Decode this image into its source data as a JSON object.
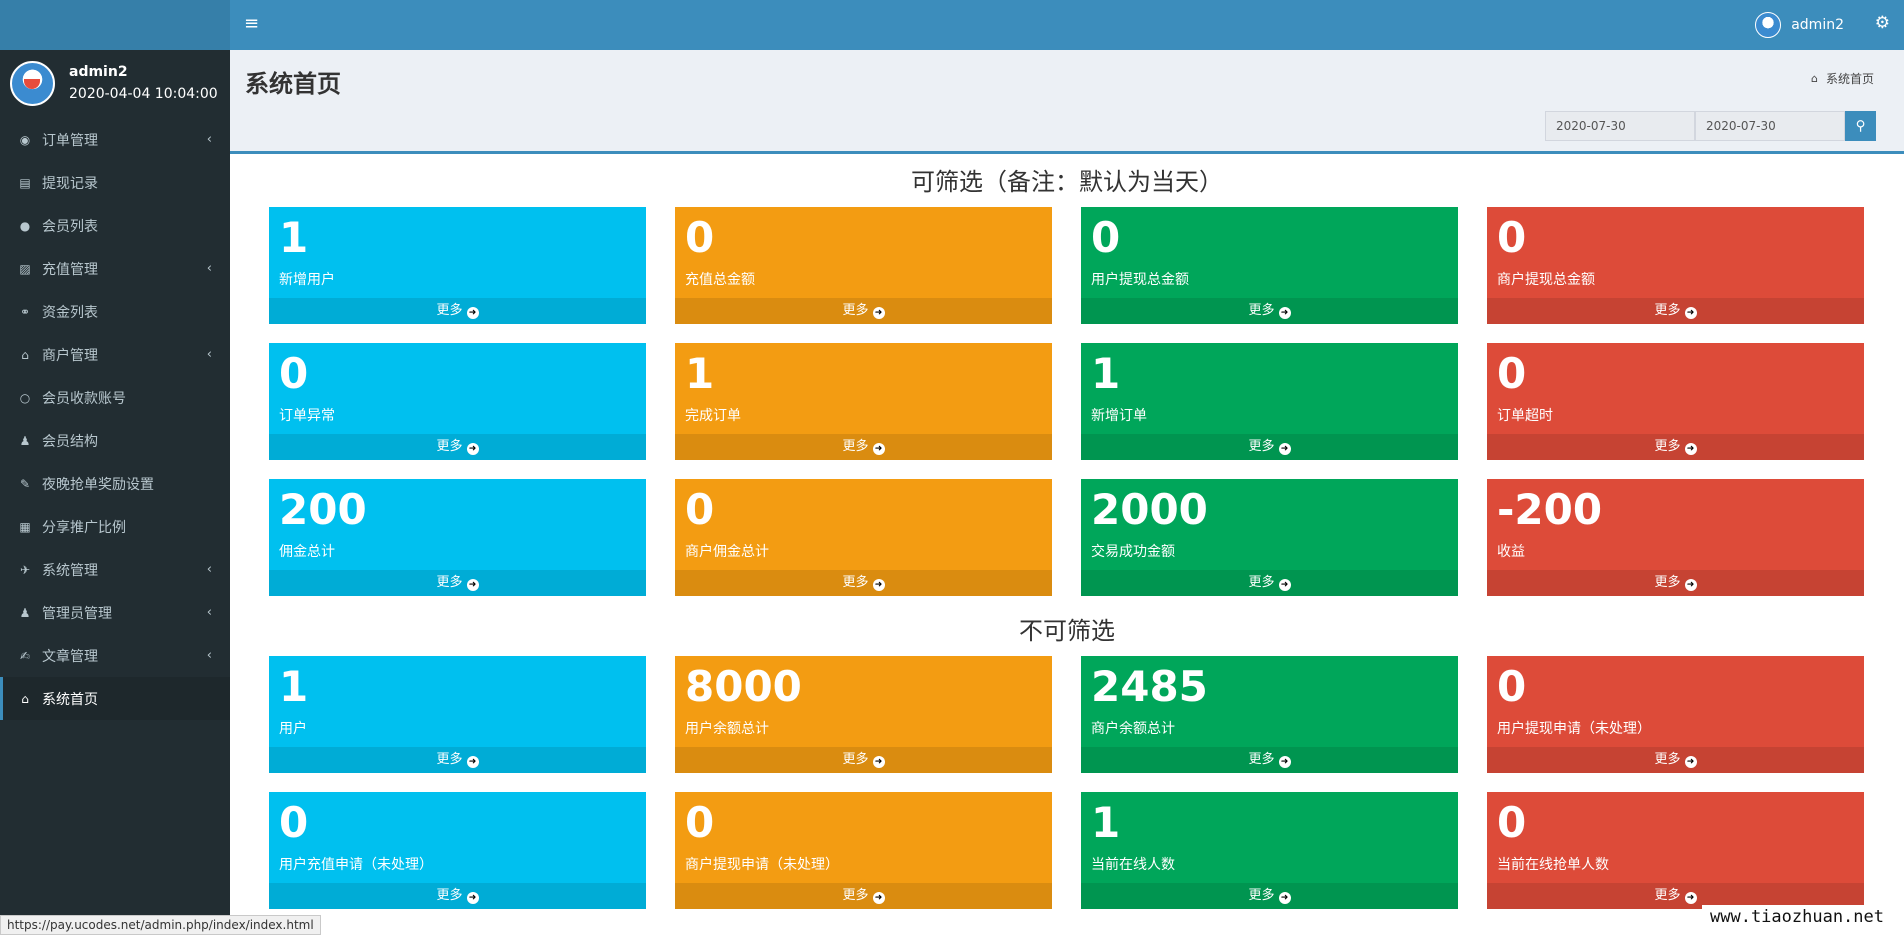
{
  "sidebar": {
    "user": {
      "name": "admin2",
      "time": "2020-04-04 10:04:00"
    },
    "items": [
      {
        "label": "订单管理",
        "icon": "◉",
        "chevron": true
      },
      {
        "label": "提现记录",
        "icon": "▤",
        "chevron": false
      },
      {
        "label": "会员列表",
        "icon": "●",
        "chevron": false
      },
      {
        "label": "充值管理",
        "icon": "▨",
        "chevron": true
      },
      {
        "label": "资金列表",
        "icon": "⚭",
        "chevron": false
      },
      {
        "label": "商户管理",
        "icon": "⌂",
        "chevron": true
      },
      {
        "label": "会员收款账号",
        "icon": "○",
        "chevron": false
      },
      {
        "label": "会员结构",
        "icon": "♟",
        "chevron": false
      },
      {
        "label": "夜晚抢单奖励设置",
        "icon": "✎",
        "chevron": false
      },
      {
        "label": "分享推广比例",
        "icon": "▦",
        "chevron": false
      },
      {
        "label": "系统管理",
        "icon": "✈",
        "chevron": true
      },
      {
        "label": "管理员管理",
        "icon": "♟",
        "chevron": true
      },
      {
        "label": "文章管理",
        "icon": "✍",
        "chevron": true
      },
      {
        "label": "系统首页",
        "icon": "⌂",
        "chevron": false
      }
    ],
    "chevron_glyph": "‹"
  },
  "header": {
    "toggle_icon": "≡",
    "username": "admin2",
    "gear_icon": "⚙"
  },
  "content": {
    "title": "系统首页",
    "breadcrumb_icon": "⌂",
    "breadcrumb": "系统首页",
    "date_from": "2020-07-30",
    "date_to": "2020-07-30",
    "search_icon": "⚲"
  },
  "sections": {
    "filterable": "可筛选（备注：默认为当天）",
    "non_filterable": "不可筛选"
  },
  "more_label": "更多",
  "more_arrow": "➜",
  "cards_filterable": [
    {
      "value": "1",
      "label": "新增用户"
    },
    {
      "value": "0",
      "label": "充值总金额"
    },
    {
      "value": "0",
      "label": "用户提现总金额"
    },
    {
      "value": "0",
      "label": "商户提现总金额"
    },
    {
      "value": "0",
      "label": "订单异常"
    },
    {
      "value": "1",
      "label": "完成订单"
    },
    {
      "value": "1",
      "label": "新增订单"
    },
    {
      "value": "0",
      "label": "订单超时"
    },
    {
      "value": "200",
      "label": "佣金总计"
    },
    {
      "value": "0",
      "label": "商户佣金总计"
    },
    {
      "value": "2000",
      "label": "交易成功金额"
    },
    {
      "value": "-200",
      "label": "收益"
    }
  ],
  "cards_non_filterable": [
    {
      "value": "1",
      "label": "用户"
    },
    {
      "value": "8000",
      "label": "用户余额总计"
    },
    {
      "value": "2485",
      "label": "商户余额总计"
    },
    {
      "value": "0",
      "label": "用户提现申请（未处理）"
    },
    {
      "value": "0",
      "label": "用户充值申请（未处理）"
    },
    {
      "value": "0",
      "label": "商户提现申请（未处理）"
    },
    {
      "value": "1",
      "label": "当前在线人数"
    },
    {
      "value": "0",
      "label": "当前在线抢单人数"
    }
  ],
  "colors": {
    "aqua": "#00c0ef",
    "yellow": "#f39c12",
    "green": "#00a65a",
    "red": "#dd4b39",
    "primary": "#3c8dbc"
  },
  "statusbar": "https://pay.ucodes.net/admin.php/index/index.html",
  "watermark": "www.tiaozhuan.net"
}
